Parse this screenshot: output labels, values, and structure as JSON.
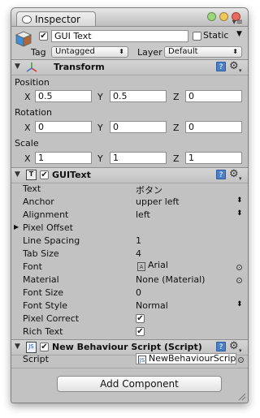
{
  "window": {
    "tab_label": "Inspector"
  },
  "object": {
    "name": "GUI Text",
    "active": true,
    "static_label": "Static",
    "static_checked": false,
    "tag_label": "Tag",
    "tag_value": "Untagged",
    "layer_label": "Layer",
    "layer_value": "Default"
  },
  "transform": {
    "title": "Transform",
    "position": {
      "label": "Position",
      "x": "0.5",
      "y": "0.5",
      "z": "0"
    },
    "rotation": {
      "label": "Rotation",
      "x": "0",
      "y": "0",
      "z": "0"
    },
    "scale": {
      "label": "Scale",
      "x": "1",
      "y": "1",
      "z": "1"
    },
    "axis_x": "X",
    "axis_y": "Y",
    "axis_z": "Z"
  },
  "guitext": {
    "title": "GUIText",
    "enabled": true,
    "props": {
      "text": {
        "label": "Text",
        "value": "ボタン"
      },
      "anchor": {
        "label": "Anchor",
        "value": "upper left"
      },
      "alignment": {
        "label": "Alignment",
        "value": "left"
      },
      "pixel_offset": {
        "label": "Pixel Offset"
      },
      "line_spacing": {
        "label": "Line Spacing",
        "value": "1"
      },
      "tab_size": {
        "label": "Tab Size",
        "value": "4"
      },
      "font": {
        "label": "Font",
        "value": "Arial"
      },
      "material": {
        "label": "Material",
        "value": "None (Material)"
      },
      "font_size": {
        "label": "Font Size",
        "value": "0"
      },
      "font_style": {
        "label": "Font Style",
        "value": "Normal"
      },
      "pixel_correct": {
        "label": "Pixel Correct",
        "checked": true
      },
      "rich_text": {
        "label": "Rich Text",
        "checked": true
      }
    }
  },
  "script_component": {
    "title": "New Behaviour Script (Script)",
    "enabled": true,
    "script_label": "Script",
    "script_value": "NewBehaviourScript"
  },
  "add_component_label": "Add Component",
  "colors": {
    "panel_bg": "#c2c2c2",
    "help_blue": "#4d7fc5",
    "close_red": "#e0443e",
    "minimize_yellow": "#dea123",
    "zoom_green": "#1aab29"
  }
}
